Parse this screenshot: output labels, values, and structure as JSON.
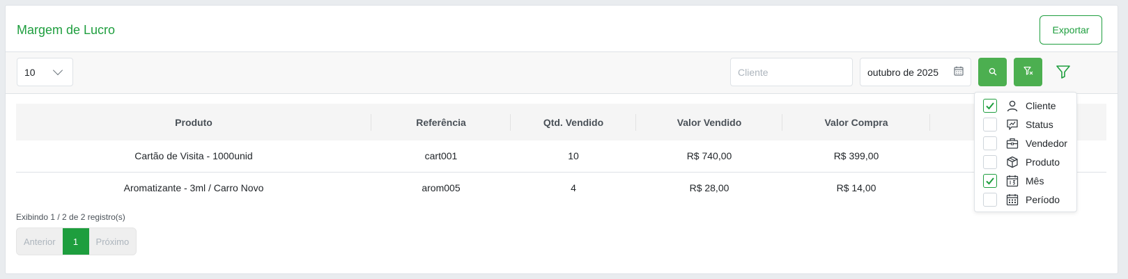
{
  "header": {
    "title": "Margem de Lucro",
    "export_label": "Exportar"
  },
  "toolbar": {
    "per_page": "10",
    "cliente_placeholder": "Cliente",
    "month_value": "outubro de 2025"
  },
  "table": {
    "columns": [
      "Produto",
      "Referência",
      "Qtd. Vendido",
      "Valor Vendido",
      "Valor Compra",
      ""
    ],
    "rows": [
      [
        "Cartão de Visita - 1000unid",
        "cart001",
        "10",
        "R$ 740,00",
        "R$ 399,00",
        ""
      ],
      [
        "Aromatizante - 3ml / Carro Novo",
        "arom005",
        "4",
        "R$ 28,00",
        "R$ 14,00",
        ""
      ]
    ]
  },
  "footer": {
    "info": "Exibindo 1 / 2 de 2 registro(s)",
    "prev_label": "Anterior",
    "current_page": "1",
    "next_label": "Próximo"
  },
  "filter_menu": {
    "items": [
      {
        "label": "Cliente",
        "checked": true,
        "icon": "user-icon"
      },
      {
        "label": "Status",
        "checked": false,
        "icon": "status-icon"
      },
      {
        "label": "Vendedor",
        "checked": false,
        "icon": "briefcase-icon"
      },
      {
        "label": "Produto",
        "checked": false,
        "icon": "box-icon"
      },
      {
        "label": "Mês",
        "checked": true,
        "icon": "calendar-month-icon"
      },
      {
        "label": "Período",
        "checked": false,
        "icon": "calendar-period-icon"
      }
    ]
  },
  "colors": {
    "accent": "#1e9e3e",
    "button_green": "#4caf50"
  }
}
